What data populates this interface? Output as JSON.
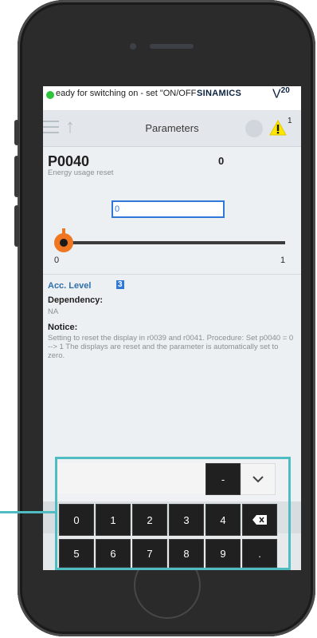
{
  "status": {
    "message": "eady for switching on - set \"ON/OFF",
    "brand": "SINAMICS",
    "version_main": "V",
    "version_sup": "20"
  },
  "toolbar": {
    "title": "Parameters",
    "warning_count": "1"
  },
  "parameter": {
    "id": "P0040",
    "description": "Energy usage reset",
    "value": "0",
    "input_value": "0",
    "slider_min": "0",
    "slider_max": "1",
    "slider_level": 0
  },
  "details": {
    "acc_level_label": "Acc. Level",
    "acc_level_value": "3",
    "dependency_label": "Dependency:",
    "dependency_value": "NA",
    "notice_label": "Notice:",
    "notice_text": "Setting to reset the display in r0039 and r0041. Procedure: Set p0040 = 0 --> 1 The displays are reset and the parameter is automatically set to zero."
  },
  "keypad": {
    "minus": "-",
    "row1": [
      "0",
      "1",
      "2",
      "3",
      "4"
    ],
    "row2": [
      "5",
      "6",
      "7",
      "8",
      "9",
      "."
    ]
  },
  "colors": {
    "accent": "#4fbcc1",
    "slider_handle": "#f07621",
    "input_border": "#2f78d8",
    "status_ok": "#2fc43c",
    "warning": "#ffe600"
  }
}
